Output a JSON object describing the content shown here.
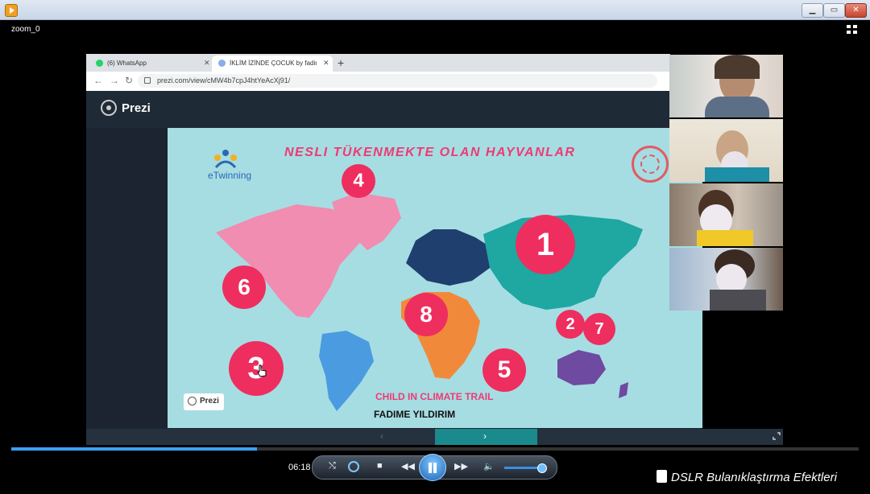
{
  "window": {
    "title": ""
  },
  "zoom": {
    "label": "zoom_0"
  },
  "browser": {
    "tabs": [
      {
        "label": "(6) WhatsApp",
        "active": false
      },
      {
        "label": "İKLİM İZİNDE ÇOCUK by fadime",
        "active": true
      }
    ],
    "url": "prezi.com/view/cMW4b7cpJ4htYeAcXj91/"
  },
  "prezi": {
    "logo_text": "Prezi",
    "watermark": "Prezi"
  },
  "slide": {
    "title": "NESLI  TÜKENMEKTE OLAN HAYVANLAR",
    "twinning": "eTwinning",
    "subtitle": "CHILD IN CLIMATE TRAIL",
    "author": "FADIME YILDIRIM",
    "markers": [
      "1",
      "2",
      "3",
      "4",
      "5",
      "6",
      "7",
      "8"
    ]
  },
  "player": {
    "time": "06:18",
    "progress": 0.29,
    "volume": 0.88
  },
  "overlay": {
    "caption": "DSLR Bulanıklaştırma Efektleri"
  },
  "colors": {
    "accent_pink": "#ee2e5f",
    "map_teal": "#1fa7a2",
    "map_pink": "#f08db0",
    "map_blue": "#4a9be0",
    "map_orange": "#f08a3a",
    "map_purple": "#6e4aa0",
    "ocean": "#a6dde3"
  }
}
